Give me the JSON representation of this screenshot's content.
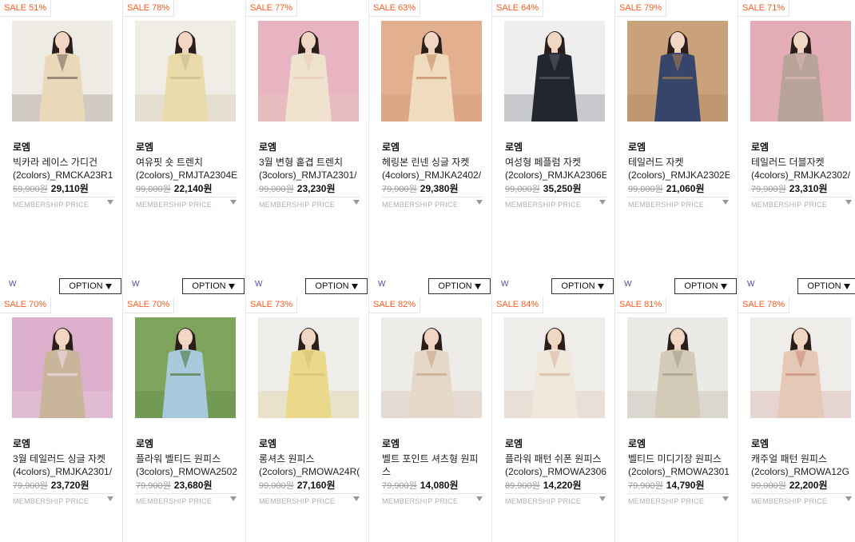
{
  "membership_label": "MEMBERSHIP PRICE",
  "option_label": "OPTION",
  "w_label": "W",
  "products": [
    {
      "sale": "SALE 51%",
      "brand": "로엠",
      "line1": "빅카라 레이스 가디건",
      "line2": "(2colors)_RMCKA23R1",
      "orig": "59,900원",
      "price": "29,110원",
      "colors": {
        "bg": "#eeeae4",
        "dress": "#ead9b8",
        "accent": "#7a6a5a"
      }
    },
    {
      "sale": "SALE 78%",
      "brand": "로엠",
      "line1": "여유핏 숏 트렌치",
      "line2": "(2colors)_RMJTA2304E",
      "orig": "99,000원",
      "price": "22,140원",
      "colors": {
        "bg": "#f0ece6",
        "dress": "#eadcaa",
        "accent": "#c8b890"
      }
    },
    {
      "sale": "SALE 77%",
      "brand": "로엠",
      "line1": "3월 변형 홑겹 트렌치",
      "line2": "(3colors)_RMJTA2301/",
      "orig": "99,000원",
      "price": "23,230원",
      "colors": {
        "bg": "#e8b4c2",
        "dress": "#efe2cf",
        "accent": "#e6cfb5"
      }
    },
    {
      "sale": "SALE 63%",
      "brand": "로엠",
      "line1": "헤링본 린넨 싱글 자켓",
      "line2": "(4colors)_RMJKA2402/",
      "orig": "79,900원",
      "price": "29,380원",
      "colors": {
        "bg": "#e3b08f",
        "dress": "#efdcbf",
        "accent": "#c58a62"
      }
    },
    {
      "sale": "SALE 64%",
      "brand": "로엠",
      "line1": "여성형 페플럼 자켓",
      "line2": "(2colors)_RMJKA2306E",
      "orig": "99,000원",
      "price": "35,250원",
      "colors": {
        "bg": "#eeeeee",
        "dress": "#23262f",
        "accent": "#565a66"
      }
    },
    {
      "sale": "SALE 79%",
      "brand": "로엠",
      "line1": "테일러드 자켓",
      "line2": "(2colors)_RMJKA2302E",
      "orig": "99,000원",
      "price": "21,060원",
      "colors": {
        "bg": "#c9a27b",
        "dress": "#37456a",
        "accent": "#a27a54"
      }
    },
    {
      "sale": "SALE 71%",
      "brand": "로엠",
      "line1": "테일러드 더블자켓",
      "line2": "(4colors)_RMJKA2302/",
      "orig": "79,900원",
      "price": "23,310원",
      "colors": {
        "bg": "#e4acb6",
        "dress": "#b7a397",
        "accent": "#d9b8b0"
      }
    },
    {
      "sale": "SALE 70%",
      "brand": "로엠",
      "line1": "3월 테일러드 싱글 자켓",
      "line2": "(4colors)_RMJKA2301/",
      "orig": "79,900원",
      "price": "23,720원",
      "colors": {
        "bg": "#dcb0cc",
        "dress": "#c8b59a",
        "accent": "#f1dbe8"
      }
    },
    {
      "sale": "SALE 70%",
      "brand": "로엠",
      "line1": "플라워 벨티드 원피스",
      "line2": "(3colors)_RMOWA2502",
      "orig": "79,900원",
      "price": "23,680원",
      "colors": {
        "bg": "#7fa45c",
        "dress": "#a9c9dc",
        "accent": "#4d7a3c"
      }
    },
    {
      "sale": "SALE 73%",
      "brand": "로엠",
      "line1": "롱셔츠 원피스",
      "line2": "(2colors)_RMOWA24R(",
      "orig": "99,000원",
      "price": "27,160원",
      "colors": {
        "bg": "#eeede9",
        "dress": "#ead98a",
        "accent": "#d6c26e"
      }
    },
    {
      "sale": "SALE 82%",
      "brand": "로엠",
      "line1": "벨트 포인트 셔츠형 원피",
      "line2": "스",
      "orig": "79,900원",
      "price": "14,080원",
      "colors": {
        "bg": "#eeece8",
        "dress": "#e6d8c8",
        "accent": "#c9a58a"
      }
    },
    {
      "sale": "SALE 84%",
      "brand": "로엠",
      "line1": "플라워 패턴 쉬폰 원피스",
      "line2": "(2colors)_RMOWA2306",
      "orig": "89,900원",
      "price": "14,220원",
      "colors": {
        "bg": "#efedea",
        "dress": "#f1e8dc",
        "accent": "#d9b8a0"
      }
    },
    {
      "sale": "SALE 81%",
      "brand": "로엠",
      "line1": "벨티드 미디기장 원피스",
      "line2": "(2colors)_RMOWA2301",
      "orig": "79,900원",
      "price": "14,790원",
      "colors": {
        "bg": "#eceae6",
        "dress": "#d3cbb8",
        "accent": "#a89b86"
      }
    },
    {
      "sale": "SALE 78%",
      "brand": "로엠",
      "line1": "캐주얼 패턴 원피스",
      "line2": "(2colors)_RMOWA12G",
      "orig": "99,000원",
      "price": "22,200원",
      "colors": {
        "bg": "#efedea",
        "dress": "#e6c8b6",
        "accent": "#c98c7e"
      }
    }
  ]
}
